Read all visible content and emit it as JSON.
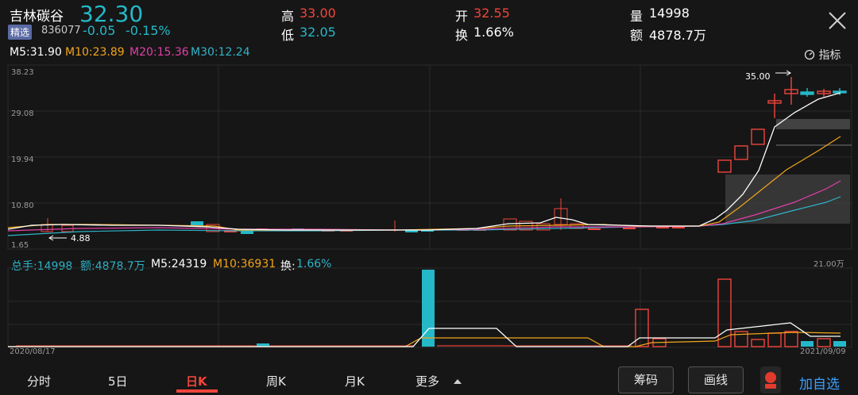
{
  "header": {
    "stock_name": "吉林碳谷",
    "price": "32.30",
    "badge": "精选",
    "code": "836077",
    "change": "-0.05",
    "change_pct": "-0.15%",
    "high_label": "高",
    "high_value": "33.00",
    "low_label": "低",
    "low_value": "32.05",
    "open_label": "开",
    "open_value": "32.55",
    "turnover_label": "换",
    "turnover_value": "1.66%",
    "volume_label": "量",
    "volume_value": "14998",
    "amount_label": "额",
    "amount_value": "4878.7万"
  },
  "ma": {
    "m5": "M5:31.90",
    "m10": "M10:23.89",
    "m20": "M20:15.36",
    "m30": "M30:12.24",
    "indicator": "指标"
  },
  "price_axis": {
    "y1": "38.23",
    "y2": "29.08",
    "y3": "19.94",
    "y4": "10.80",
    "y5": "1.65"
  },
  "annotations": {
    "max_label": "35.00",
    "min_label": "4.88"
  },
  "volume_info": {
    "total": "总手:14998",
    "amount": "额:4878.7万",
    "m5": "M5:24319",
    "m10": "M10:36931",
    "turnover_label": "换:",
    "turnover_value": "1.66%",
    "max_label": "21.00万"
  },
  "dates": {
    "start": "2020/08/17",
    "end": "2021/09/09"
  },
  "tabs": [
    {
      "label": "分时"
    },
    {
      "label": "5日"
    },
    {
      "label": "日K"
    },
    {
      "label": "周K"
    },
    {
      "label": "月K"
    },
    {
      "label": "更多"
    }
  ],
  "buttons": {
    "chips": "筹码",
    "draw": "画线",
    "add_favorite": "加自选"
  },
  "colors": {
    "up": "#f0453b",
    "down": "#25b8c8",
    "ma5": "#ffffff",
    "ma10": "#f2a51a",
    "ma20": "#e23fa8",
    "ma30": "#2fb3c9"
  }
}
